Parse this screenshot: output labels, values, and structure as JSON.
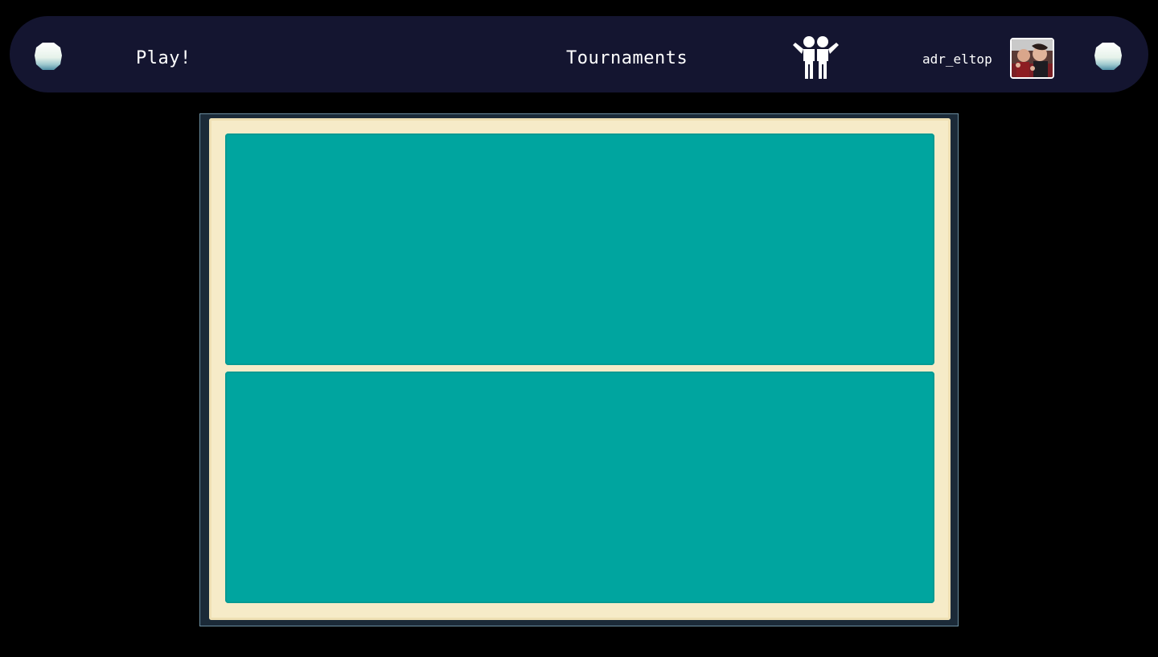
{
  "navbar": {
    "play_label": "Play!",
    "tournaments_label": "Tournaments",
    "friends_icon": "friends-icon",
    "username": "adr_eltop",
    "avatar_icon": "user-avatar-photo",
    "orb_icon": "moon-orb-icon"
  },
  "game": {
    "table_colors": {
      "surface": "#00a59f",
      "border": "#f6ebc8",
      "frame": "#1b2a38",
      "navbar": "#141530"
    }
  }
}
